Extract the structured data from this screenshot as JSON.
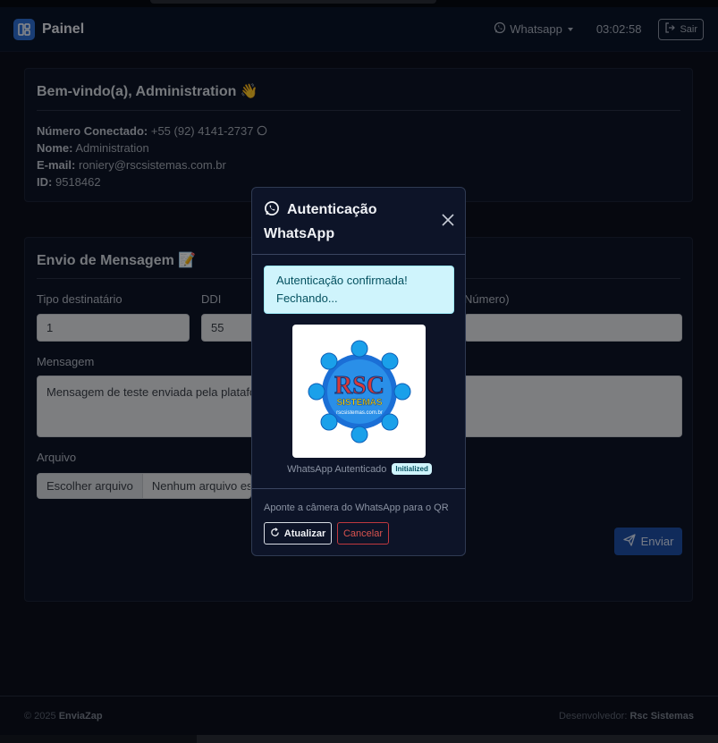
{
  "navbar": {
    "brand": "Painel",
    "whatsapp_menu": "Whatsapp",
    "clock": "03:02:58",
    "logout_label": "Sair"
  },
  "welcome": {
    "title": "Bem-vindo(a), Administration 👋",
    "connected_label": "Número Conectado:",
    "connected_value": "+55 (92) 4141-2737",
    "name_label": "Nome:",
    "name_value": "Administration",
    "email_label": "E-mail:",
    "email_value": "roniery@rscsistemas.com.br",
    "id_label": "ID:",
    "id_value": "9518462"
  },
  "send": {
    "title": "Envio de Mensagem 📝",
    "tipo_label": "Tipo destinatário",
    "tipo_value": "1",
    "ddi_label": "DDI",
    "ddi_value": "55",
    "numero_label": "Número)",
    "mensagem_label": "Mensagem",
    "mensagem_value": "Mensagem de teste enviada pela platafo",
    "arquivo_label": "Arquivo",
    "file_button": "Escolher arquivo",
    "file_name": "Nenhum arquivo esc",
    "send_button": "Enviar"
  },
  "footer": {
    "copyright_prefix": "© 2025",
    "copyright_brand": "EnviaZap",
    "developer_label": "Desenvolvedor:",
    "developer_name": "Rsc Sistemas"
  },
  "modal": {
    "title": "Autenticação WhatsApp",
    "alert": "Autenticação confirmada! Fechando...",
    "logo_line1": "RSC",
    "logo_line2": "SISTEMAS",
    "logo_url": "rscsistemas.com.br",
    "status_text": "WhatsApp Autenticado",
    "status_badge": "Initialized",
    "hint": "Aponte a câmera do WhatsApp para o QR",
    "refresh_button": "Atualizar",
    "cancel_button": "Cancelar"
  },
  "colors": {
    "background": "#0b0f1c",
    "accent": "#1e4fa6",
    "alert_bg": "#cff4fc",
    "danger": "#d9534f"
  }
}
